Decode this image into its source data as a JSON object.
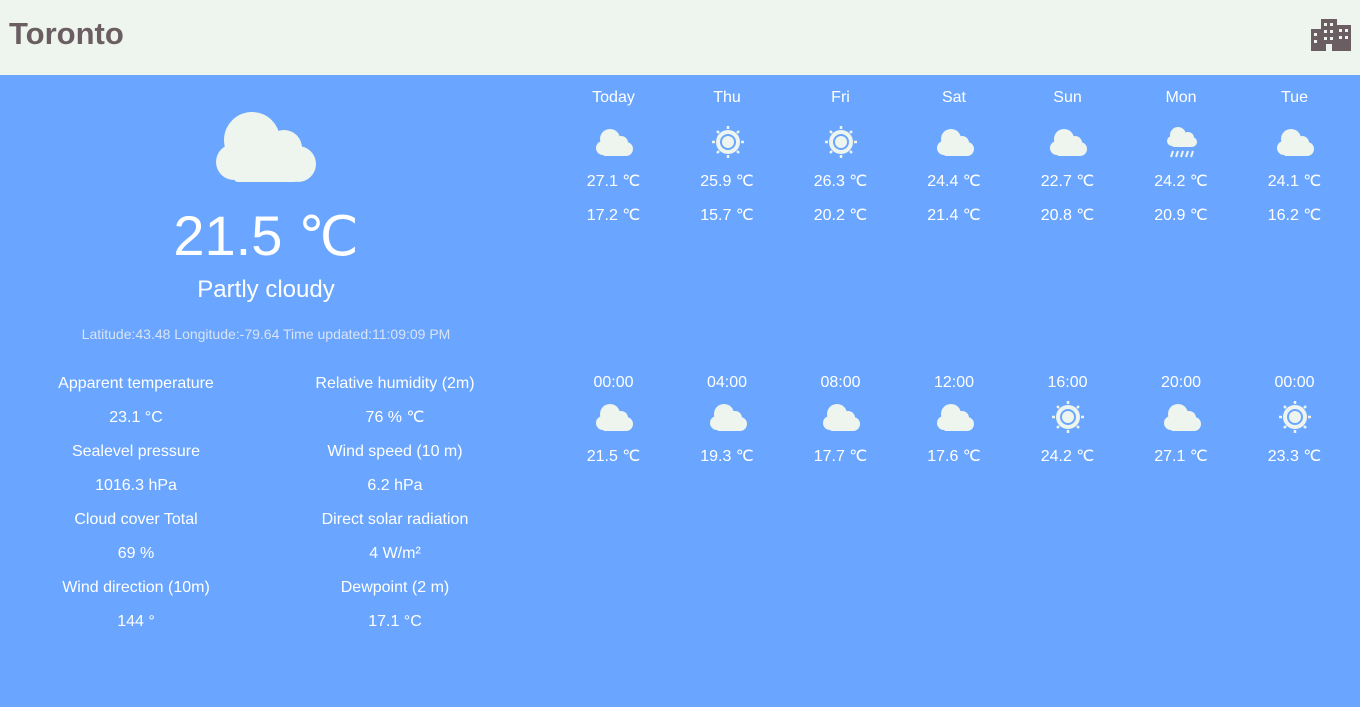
{
  "header": {
    "city": "Toronto",
    "city_icon": "city-buildings-icon"
  },
  "current": {
    "icon": "cloud-icon",
    "temperature": "21.5",
    "temperature_unit": "℃",
    "condition": "Partly cloudy",
    "meta": "Latitude:43.48 Longitude:-79.64 Time updated:11:09:09 PM",
    "details": [
      {
        "label": "Apparent temperature",
        "value": "23.1 °C"
      },
      {
        "label": "Relative humidity (2m)",
        "value": "76 % ℃"
      },
      {
        "label": "Sealevel pressure",
        "value": "1016.3 hPa"
      },
      {
        "label": "Wind speed (10 m)",
        "value": "6.2 hPa"
      },
      {
        "label": "Cloud cover Total",
        "value": "69 %"
      },
      {
        "label": "Direct solar radiation",
        "value": "4 W/m²"
      },
      {
        "label": "Wind direction (10m)",
        "value": "144 °"
      },
      {
        "label": "Dewpoint (2 m)",
        "value": "17.1 °C"
      }
    ]
  },
  "daily": [
    {
      "day": "Today",
      "icon": "cloud-icon",
      "max": "27.1 ℃",
      "min": "17.2 ℃"
    },
    {
      "day": "Thu",
      "icon": "sun-icon",
      "max": "25.9 ℃",
      "min": "15.7 ℃"
    },
    {
      "day": "Fri",
      "icon": "sun-icon",
      "max": "26.3 ℃",
      "min": "20.2 ℃"
    },
    {
      "day": "Sat",
      "icon": "cloud-icon",
      "max": "24.4 ℃",
      "min": "21.4 ℃"
    },
    {
      "day": "Sun",
      "icon": "cloud-icon",
      "max": "22.7 ℃",
      "min": "20.8 ℃"
    },
    {
      "day": "Mon",
      "icon": "rain-icon",
      "max": "24.2 ℃",
      "min": "20.9 ℃"
    },
    {
      "day": "Tue",
      "icon": "cloud-icon",
      "max": "24.1 ℃",
      "min": "16.2 ℃"
    }
  ],
  "hourly": [
    {
      "time": "00:00",
      "icon": "cloud-icon",
      "temp": "21.5 ℃"
    },
    {
      "time": "04:00",
      "icon": "cloud-icon",
      "temp": "19.3 ℃"
    },
    {
      "time": "08:00",
      "icon": "cloud-icon",
      "temp": "17.7 ℃"
    },
    {
      "time": "12:00",
      "icon": "cloud-icon",
      "temp": "17.6 ℃"
    },
    {
      "time": "16:00",
      "icon": "sun-icon",
      "temp": "24.2 ℃"
    },
    {
      "time": "20:00",
      "icon": "cloud-icon",
      "temp": "27.1 ℃"
    },
    {
      "time": "00:00",
      "icon": "sun-icon",
      "temp": "23.3 ℃"
    }
  ],
  "colors": {
    "background": "#6aa6ff",
    "header": "#eef5ee",
    "city": "#6a5e62",
    "icon": "#eef5ee"
  }
}
